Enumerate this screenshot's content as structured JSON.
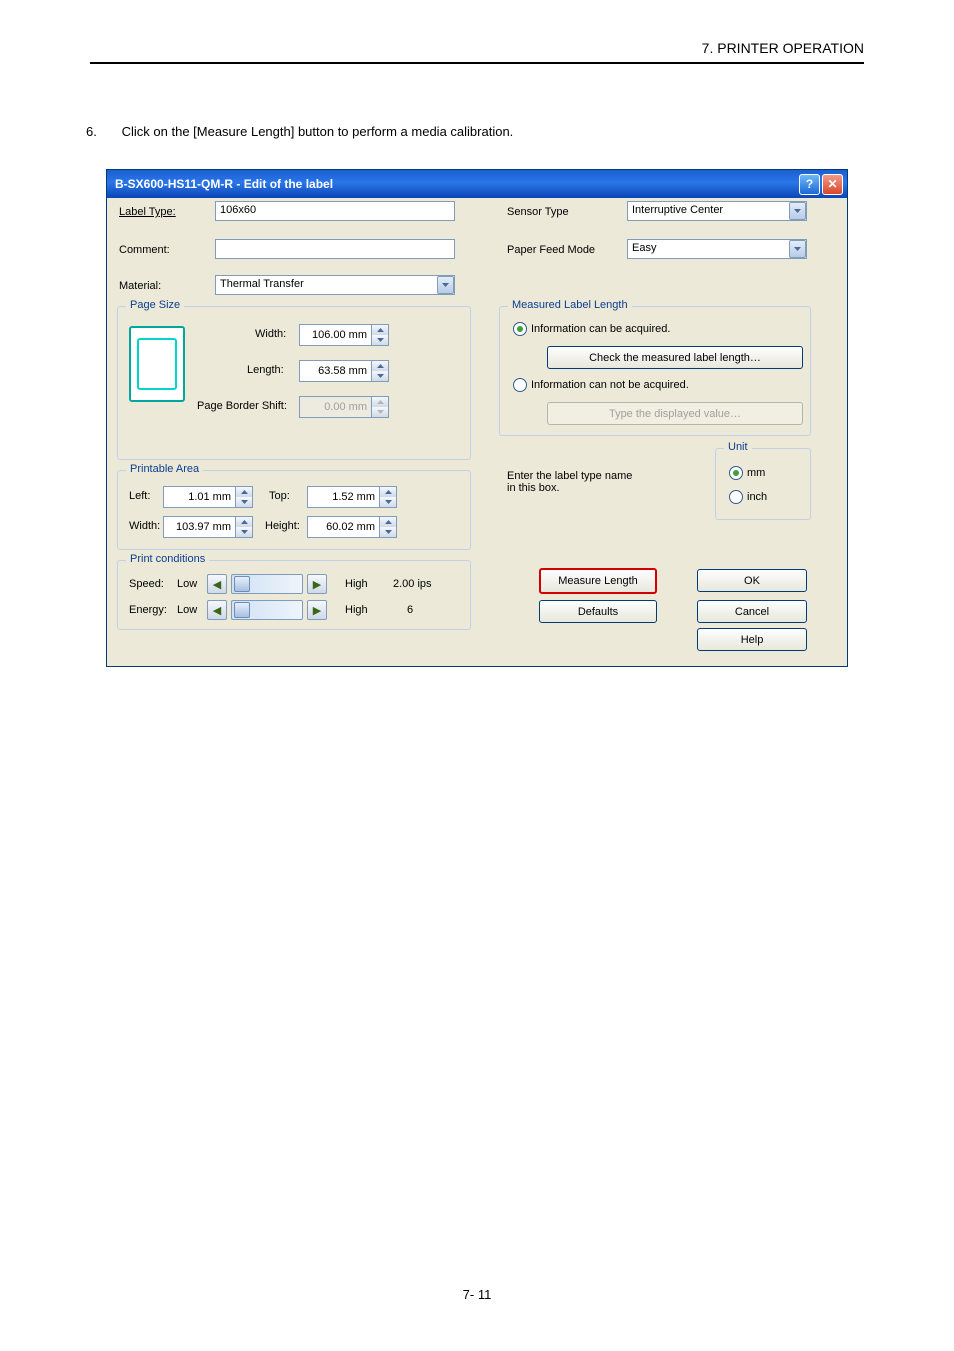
{
  "doc": {
    "section_header": "7. PRINTER OPERATION",
    "instruction_number": "6.",
    "instruction_text": "Click on the [Measure Length] button to perform a media calibration.",
    "page_number": "7- 11"
  },
  "dialog": {
    "title": "B-SX600-HS11-QM-R - Edit of the label",
    "fields": {
      "label_type_label": "Label Type:",
      "label_type_value": "106x60",
      "comment_label": "Comment:",
      "comment_value": "",
      "material_label": "Material:",
      "material_value": "Thermal Transfer",
      "sensor_type_label": "Sensor Type",
      "sensor_type_value": "Interruptive Center",
      "paper_feed_label": "Paper Feed Mode",
      "paper_feed_value": "Easy"
    },
    "page_size": {
      "legend": "Page Size",
      "width_label": "Width:",
      "width_value": "106.00 mm",
      "length_label": "Length:",
      "length_value": "63.58 mm",
      "border_label": "Page Border Shift:",
      "border_value": "0.00 mm"
    },
    "printable": {
      "legend": "Printable Area",
      "left_label": "Left:",
      "left_value": "1.01 mm",
      "top_label": "Top:",
      "top_value": "1.52 mm",
      "width_label": "Width:",
      "width_value": "103.97 mm",
      "height_label": "Height:",
      "height_value": "60.02 mm"
    },
    "measured": {
      "legend": "Measured Label Length",
      "opt1": "Information can be acquired.",
      "check_btn": "Check the measured label length…",
      "opt2": "Information can not be acquired.",
      "type_btn": "Type the displayed value…",
      "enter_label": "Enter the label type name in this box."
    },
    "unit": {
      "legend": "Unit",
      "mm": "mm",
      "inch": "inch"
    },
    "print_cond": {
      "legend": "Print conditions",
      "speed_label": "Speed:",
      "speed_low": "Low",
      "speed_high": "High",
      "speed_value": "2.00 ips",
      "energy_label": "Energy:",
      "energy_low": "Low",
      "energy_high": "High",
      "energy_value": "6"
    },
    "buttons": {
      "measure": "Measure Length",
      "ok": "OK",
      "defaults": "Defaults",
      "cancel": "Cancel",
      "help": "Help"
    }
  }
}
